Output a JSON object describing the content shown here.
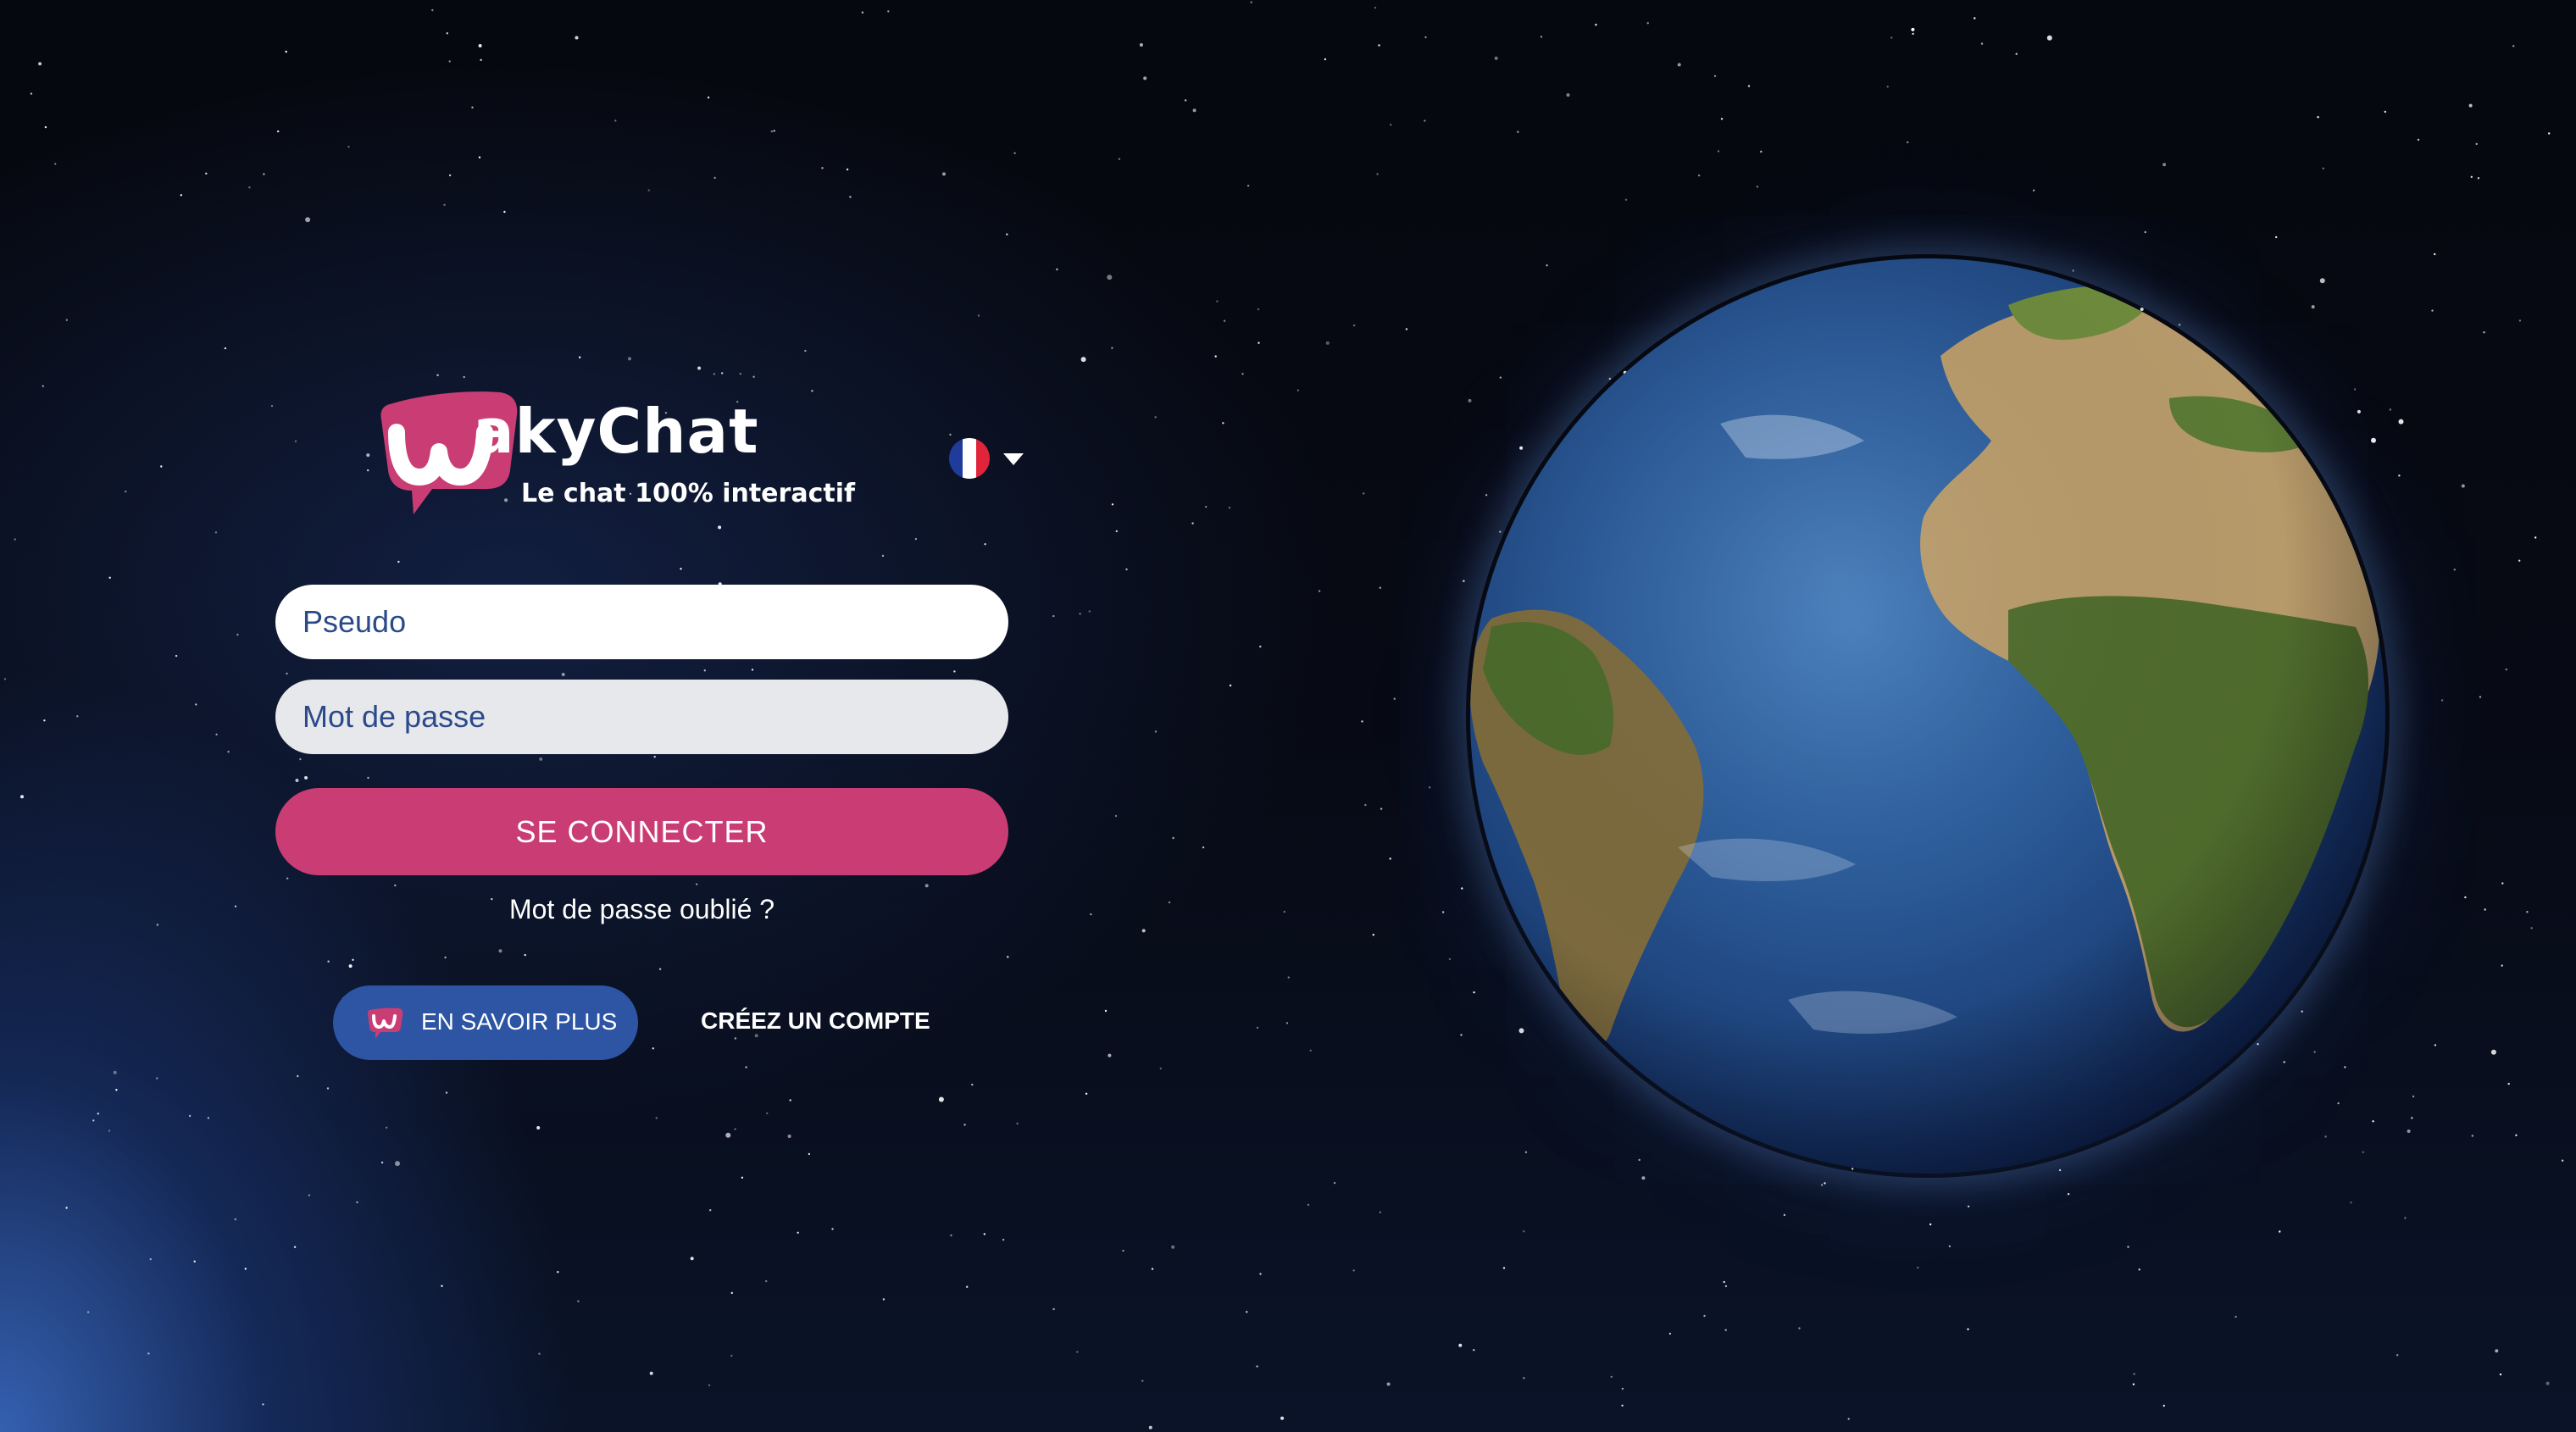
{
  "brand": {
    "name": "akyChat",
    "logo_letter": "w",
    "tagline": "Le chat 100% interactif",
    "accent_color": "#c93d74"
  },
  "language": {
    "selected": "Français",
    "flag_icon": "france-flag-icon",
    "caret_icon": "caret-down-icon"
  },
  "form": {
    "pseudo_placeholder": "Pseudo",
    "password_placeholder": "Mot de passe",
    "submit_label": "SE CONNECTER",
    "forgot_password": "Mot de passe oublié ?"
  },
  "footer": {
    "learn_more_label": "EN SAVOIR PLUS",
    "learn_more_icon": "wakychat-logo-icon",
    "create_account_label": "CRÉEZ UN COMPTE"
  },
  "background": {
    "scene": "starfield",
    "globe_icon": "earth-globe-icon"
  }
}
